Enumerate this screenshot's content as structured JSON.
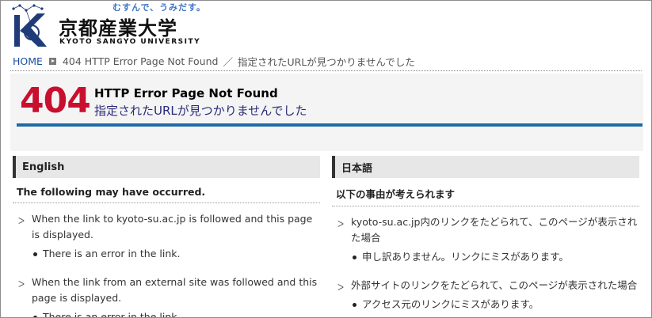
{
  "header": {
    "tagline": "むすんで、うみだす。",
    "name_ja": "京都産業大学",
    "name_en": "KYOTO SANGYO UNIVERSITY"
  },
  "breadcrumb": {
    "home": "HOME",
    "current": "404 HTTP Error Page Not Found",
    "separator": "／",
    "current_ja": "指定されたURLが見つかりませんでした"
  },
  "error": {
    "code": "404",
    "title": "HTTP Error Page Not Found",
    "subtitle": "指定されたURLが見つかりませんでした"
  },
  "english": {
    "heading": "English",
    "subheading": "The following may have occurred.",
    "reasons": [
      {
        "text": "When the link to kyoto-su.ac.jp is followed and this page is displayed.",
        "detail": "There is an error in the link."
      },
      {
        "text": "When the link from an external site was followed and this page is displayed.",
        "detail": "There is an error in the link."
      }
    ]
  },
  "japanese": {
    "heading": "日本語",
    "subheading": "以下の事由が考えられます",
    "reasons": [
      {
        "text": "kyoto-su.ac.jp内のリンクをたどられて、このページが表示された場合",
        "detail": "申し訳ありません。リンクにミスがあります。"
      },
      {
        "text": "外部サイトのリンクをたどられて、このページが表示された場合",
        "detail": "アクセス元のリンクにミスがあります。"
      }
    ]
  },
  "colors": {
    "error_red": "#c8102e",
    "accent_blue": "#1c6aa6",
    "link_blue": "#1a4fa0"
  }
}
